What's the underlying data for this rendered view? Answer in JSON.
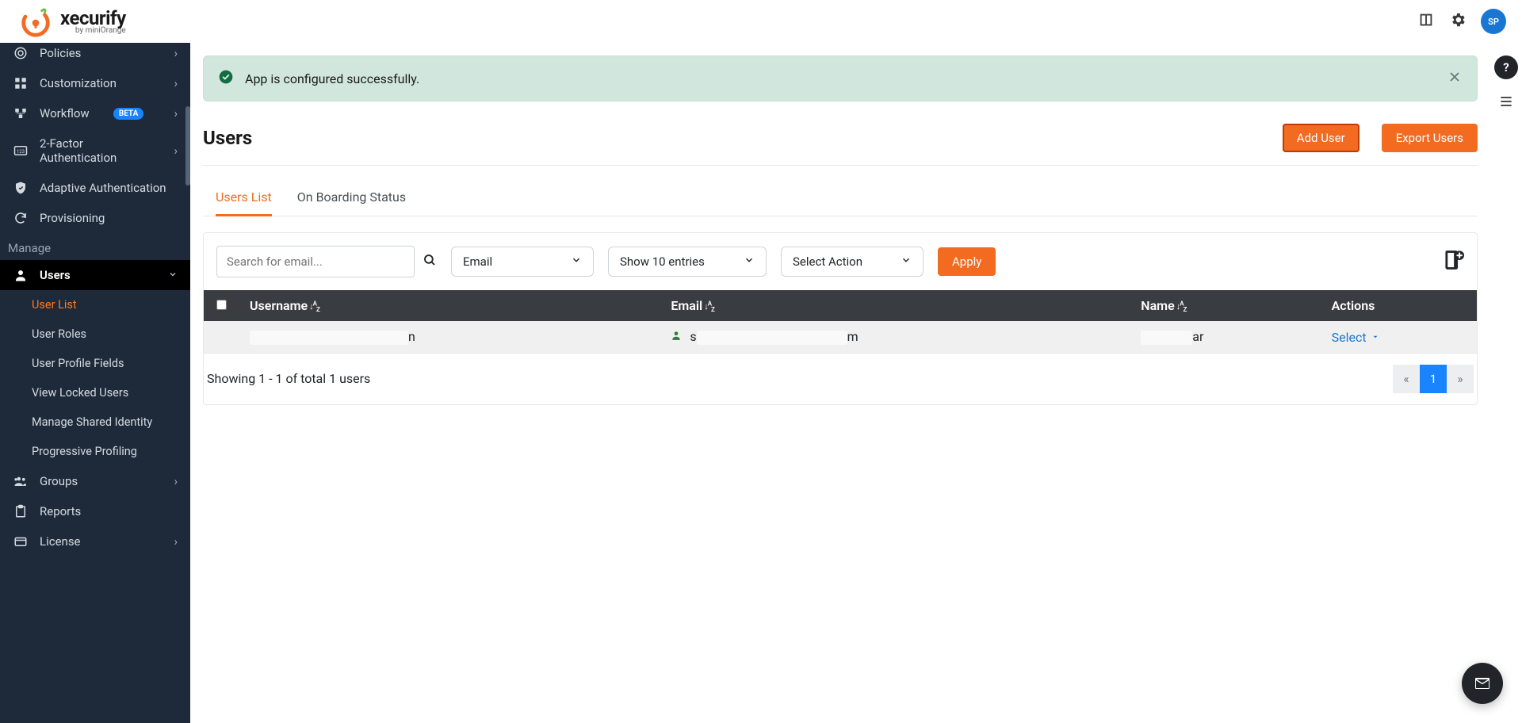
{
  "header": {
    "brand": "xecurify",
    "brand_sub": "by miniOrange",
    "avatar_initials": "SP"
  },
  "sidebar": {
    "items_top": [
      {
        "label": "Policies",
        "icon": "policies"
      },
      {
        "label": "Customization",
        "icon": "customization"
      },
      {
        "label": "Workflow",
        "icon": "workflow",
        "badge": "BETA"
      },
      {
        "label": "2-Factor Authentication",
        "icon": "2fa"
      },
      {
        "label": "Adaptive Authentication",
        "icon": "shield"
      },
      {
        "label": "Provisioning",
        "icon": "sync"
      }
    ],
    "section_label": "Manage",
    "users_label": "Users",
    "users_sub": [
      "User List",
      "User Roles",
      "User Profile Fields",
      "View Locked Users",
      "Manage Shared Identity",
      "Progressive Profiling"
    ],
    "items_bottom": [
      {
        "label": "Groups",
        "icon": "groups"
      },
      {
        "label": "Reports",
        "icon": "reports"
      },
      {
        "label": "License",
        "icon": "license"
      }
    ]
  },
  "alert": {
    "message": "App is configured successfully."
  },
  "page": {
    "title": "Users",
    "add_user_label": "Add User",
    "export_users_label": "Export Users"
  },
  "tabs": {
    "users_list": "Users List",
    "onboarding": "On Boarding Status"
  },
  "filters": {
    "search_placeholder": "Search for email...",
    "search_by": "Email",
    "page_size": "Show 10 entries",
    "bulk_action": "Select Action",
    "apply_label": "Apply"
  },
  "table": {
    "columns": {
      "username": "Username",
      "email": "Email",
      "name": "Name",
      "actions": "Actions"
    },
    "rows": [
      {
        "username_prefix": "",
        "username_suffix": "n",
        "email_prefix": "s",
        "email_suffix": "m",
        "name_prefix": "",
        "name_suffix": "ar",
        "action_label": "Select"
      }
    ],
    "footer_text": "Showing 1 - 1 of total 1 users",
    "pagination": {
      "prev": "«",
      "pages": [
        "1"
      ],
      "next": "»"
    }
  }
}
